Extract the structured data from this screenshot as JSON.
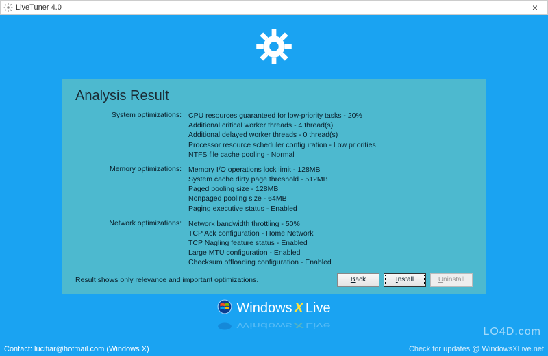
{
  "window": {
    "title": "LiveTuner 4.0",
    "close_label": "×"
  },
  "panel": {
    "heading": "Analysis Result",
    "sections": [
      {
        "label": "System optimizations:",
        "lines": [
          "CPU resources guaranteed for low-priority tasks - 20%",
          "Additional critical worker threads - 4 thread(s)",
          "Additional delayed worker threads - 0 thread(s)",
          "Processor resource scheduler configuration - Low priorities",
          "NTFS file cache pooling - Normal"
        ]
      },
      {
        "label": "Memory optimizations:",
        "lines": [
          "Memory I/O operations lock limit - 128MB",
          "System cache dirty page threshold  - 512MB",
          "Paged pooling size - 128MB",
          "Nonpaged pooling size - 64MB",
          "Paging executive status - Enabled"
        ]
      },
      {
        "label": "Network optimizations:",
        "lines": [
          "Network bandwidth throttling - 50%",
          "TCP Ack configuration  - Home Network",
          "TCP Nagling feature status - Enabled",
          "Large MTU configuration - Enabled",
          "Checksum offloading configuration - Enabled"
        ]
      }
    ],
    "footer_note": "Result shows only relevance and important optimizations.",
    "buttons": {
      "back_prefix": "B",
      "back_rest": "ack",
      "install_prefix": "I",
      "install_rest": "nstall",
      "uninstall_prefix": "U",
      "uninstall_rest": "ninstall"
    }
  },
  "brand": {
    "windows": "Windows",
    "x": "X",
    "live": "Live"
  },
  "footer": {
    "contact": "Contact: lucifiar@hotmail.com (Windows X)",
    "updates": "Check for updates @ WindowsXLive.net"
  },
  "watermark": "LO4D.com"
}
